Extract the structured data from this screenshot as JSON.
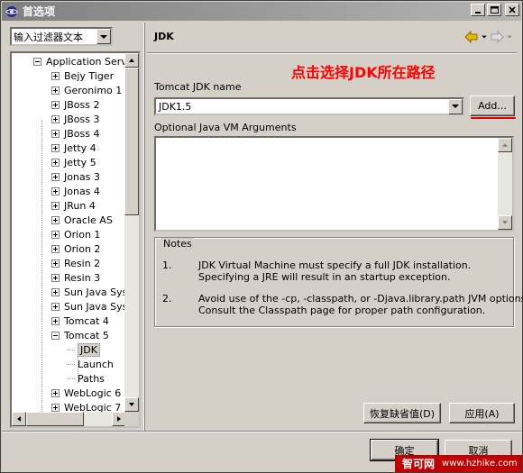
{
  "window": {
    "title": "首选项",
    "buttons": {
      "minimize": "_",
      "maximize": "□",
      "close": "✕"
    }
  },
  "filter": {
    "value": "输入过滤器文本"
  },
  "tree": {
    "items": [
      {
        "label": "Application Server",
        "level": 0,
        "expander": "minus"
      },
      {
        "label": "Bejy Tiger",
        "level": 1,
        "expander": "plus"
      },
      {
        "label": "Geronimo 1",
        "level": 1,
        "expander": "plus"
      },
      {
        "label": "JBoss 2",
        "level": 1,
        "expander": "plus"
      },
      {
        "label": "JBoss 3",
        "level": 1,
        "expander": "plus"
      },
      {
        "label": "JBoss 4",
        "level": 1,
        "expander": "plus"
      },
      {
        "label": "Jetty 4",
        "level": 1,
        "expander": "plus"
      },
      {
        "label": "Jetty 5",
        "level": 1,
        "expander": "plus"
      },
      {
        "label": "Jonas 3",
        "level": 1,
        "expander": "plus"
      },
      {
        "label": "Jonas 4",
        "level": 1,
        "expander": "plus"
      },
      {
        "label": "JRun 4",
        "level": 1,
        "expander": "plus"
      },
      {
        "label": "Oracle AS",
        "level": 1,
        "expander": "plus"
      },
      {
        "label": "Orion 1",
        "level": 1,
        "expander": "plus"
      },
      {
        "label": "Orion 2",
        "level": 1,
        "expander": "plus"
      },
      {
        "label": "Resin 2",
        "level": 1,
        "expander": "plus"
      },
      {
        "label": "Resin 3",
        "level": 1,
        "expander": "plus"
      },
      {
        "label": "Sun Java Syst",
        "level": 1,
        "expander": "plus"
      },
      {
        "label": "Sun Java Syst",
        "level": 1,
        "expander": "plus"
      },
      {
        "label": "Tomcat 4",
        "level": 1,
        "expander": "plus"
      },
      {
        "label": "Tomcat 5",
        "level": 1,
        "expander": "minus"
      },
      {
        "label": "JDK",
        "level": 2,
        "expander": "none",
        "selected": true
      },
      {
        "label": "Launch",
        "level": 2,
        "expander": "none"
      },
      {
        "label": "Paths",
        "level": 2,
        "expander": "none"
      },
      {
        "label": "WebLogic 6",
        "level": 1,
        "expander": "plus"
      },
      {
        "label": "WebLogic 7",
        "level": 1,
        "expander": "plus"
      }
    ]
  },
  "page": {
    "title": "JDK",
    "annotation": "点击选择JDK所在路径",
    "jdk_name_label": "Tomcat JDK name",
    "jdk_name_value": "JDK1.5",
    "add_button": "Add...",
    "vm_args_label": "Optional Java VM Arguments",
    "vm_args_value": "",
    "notes": {
      "legend": "Notes",
      "items": [
        {
          "num": "1.",
          "lines": [
            "JDK Virtual Machine must specify a full JDK installation.",
            "Specifying a JRE will result in an startup exception."
          ]
        },
        {
          "num": "2.",
          "lines": [
            "Avoid use of the -cp, -classpath, or -Djava.library.path JVM options.",
            "Consult the Classpath page for proper path configuration."
          ]
        }
      ]
    },
    "restore_defaults_button": "恢复缺省值(D)",
    "apply_button": "应用(A)"
  },
  "dialog": {
    "ok_button": "确定",
    "cancel_button": "取消"
  },
  "watermark": {
    "logo": "智可网",
    "url": "www.hzhike.com"
  },
  "colors": {
    "annotation": "#ff0000",
    "watermark_bg": "#c00000",
    "nav_back_arrow": "#e8b800"
  }
}
